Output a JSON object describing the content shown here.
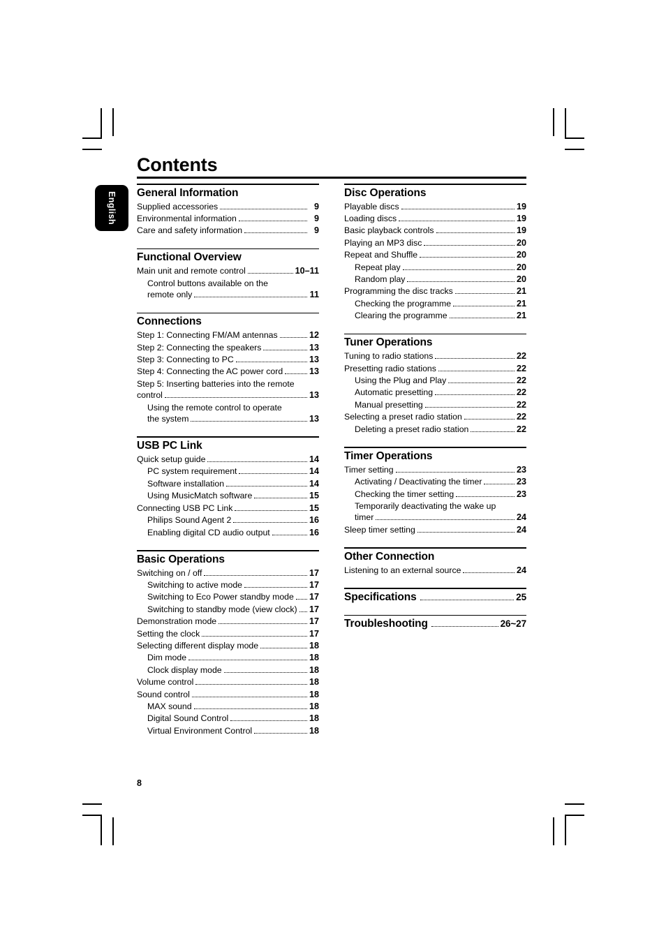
{
  "page": {
    "title": "Contents",
    "language_tab": "English",
    "folio": "8"
  },
  "left_column": [
    {
      "heading": "General Information",
      "entries": [
        {
          "text": "Supplied accessories",
          "page": "9",
          "level": 0
        },
        {
          "text": "Environmental information",
          "page": "9",
          "level": 0
        },
        {
          "text": "Care and safety information",
          "page": "9",
          "level": 0
        }
      ]
    },
    {
      "heading": "Functional Overview",
      "entries": [
        {
          "text": "Main unit and remote control",
          "page": "10–11",
          "level": 0
        },
        {
          "text": "Control buttons available on the",
          "page": "",
          "level": 1,
          "wrap": "first"
        },
        {
          "text": "remote only",
          "page": "11",
          "level": 1,
          "wrap": "last"
        }
      ]
    },
    {
      "heading": "Connections",
      "entries": [
        {
          "text": "Step 1: Connecting FM/AM antennas",
          "page": "12",
          "level": 0
        },
        {
          "text": "Step 2: Connecting the speakers",
          "page": "13",
          "level": 0
        },
        {
          "text": "Step 3: Connecting to PC",
          "page": "13",
          "level": 0
        },
        {
          "text": "Step 4: Connecting the AC power cord",
          "page": "13",
          "level": 0
        },
        {
          "text": "Step 5: Inserting batteries into the remote",
          "page": "",
          "level": 0,
          "wrap": "first"
        },
        {
          "text": "control",
          "page": "13",
          "level": 0,
          "wrap": "last"
        },
        {
          "text": "Using the remote control to operate",
          "page": "",
          "level": 1,
          "wrap": "first"
        },
        {
          "text": "the system",
          "page": "13",
          "level": 1,
          "wrap": "last"
        }
      ]
    },
    {
      "heading": "USB PC Link",
      "entries": [
        {
          "text": "Quick setup guide",
          "page": "14",
          "level": 0
        },
        {
          "text": "PC system requirement",
          "page": "14",
          "level": 1
        },
        {
          "text": "Software installation",
          "page": "14",
          "level": 1
        },
        {
          "text": "Using MusicMatch software",
          "page": "15",
          "level": 1
        },
        {
          "text": "Connecting USB PC Link",
          "page": "15",
          "level": 0
        },
        {
          "text": "Philips Sound Agent 2",
          "page": "16",
          "level": 1
        },
        {
          "text": "Enabling digital CD audio output",
          "page": "16",
          "level": 1
        }
      ]
    },
    {
      "heading": "Basic Operations",
      "entries": [
        {
          "text": "Switching on / off",
          "page": "17",
          "level": 0
        },
        {
          "text": "Switching to active mode",
          "page": "17",
          "level": 1
        },
        {
          "text": "Switching to Eco Power standby mode",
          "page": "17",
          "level": 1
        },
        {
          "text": "Switching to standby mode (view clock)",
          "page": "17",
          "level": 1
        },
        {
          "text": "Demonstration mode",
          "page": "17",
          "level": 0
        },
        {
          "text": "Setting the clock",
          "page": "17",
          "level": 0
        },
        {
          "text": "Selecting different display mode",
          "page": "18",
          "level": 0
        },
        {
          "text": "Dim mode",
          "page": "18",
          "level": 1
        },
        {
          "text": "Clock display mode",
          "page": "18",
          "level": 1
        },
        {
          "text": "Volume control",
          "page": "18",
          "level": 0
        },
        {
          "text": "Sound control",
          "page": "18",
          "level": 0
        },
        {
          "text": "MAX sound",
          "page": "18",
          "level": 1
        },
        {
          "text": "Digital Sound Control",
          "page": "18",
          "level": 1
        },
        {
          "text": "Virtual Environment Control",
          "page": "18",
          "level": 1
        }
      ]
    }
  ],
  "right_column": [
    {
      "heading": "Disc Operations",
      "entries": [
        {
          "text": "Playable discs",
          "page": "19",
          "level": 0
        },
        {
          "text": "Loading discs",
          "page": "19",
          "level": 0
        },
        {
          "text": "Basic playback controls",
          "page": "19",
          "level": 0
        },
        {
          "text": "Playing an MP3 disc",
          "page": "20",
          "level": 0
        },
        {
          "text": "Repeat and Shuffle",
          "page": "20",
          "level": 0
        },
        {
          "text": "Repeat play",
          "page": "20",
          "level": 1
        },
        {
          "text": "Random play",
          "page": "20",
          "level": 1
        },
        {
          "text": "Programming the disc tracks",
          "page": "21",
          "level": 0
        },
        {
          "text": "Checking the programme",
          "page": "21",
          "level": 1
        },
        {
          "text": "Clearing the programme",
          "page": "21",
          "level": 1
        }
      ]
    },
    {
      "heading": "Tuner Operations",
      "entries": [
        {
          "text": "Tuning to radio stations",
          "page": "22",
          "level": 0
        },
        {
          "text": "Presetting radio stations",
          "page": "22",
          "level": 0
        },
        {
          "text": "Using the Plug and Play",
          "page": "22",
          "level": 1
        },
        {
          "text": "Automatic presetting",
          "page": "22",
          "level": 1
        },
        {
          "text": "Manual presetting",
          "page": "22",
          "level": 1
        },
        {
          "text": "Selecting a preset radio station",
          "page": "22",
          "level": 0
        },
        {
          "text": "Deleting a preset radio station",
          "page": "22",
          "level": 1
        }
      ]
    },
    {
      "heading": "Timer Operations",
      "entries": [
        {
          "text": "Timer setting",
          "page": "23",
          "level": 0
        },
        {
          "text": "Activating / Deactivating the timer",
          "page": "23",
          "level": 1
        },
        {
          "text": "Checking the timer setting",
          "page": "23",
          "level": 1
        },
        {
          "text": "Temporarily deactivating the wake up",
          "page": "",
          "level": 1,
          "wrap": "first"
        },
        {
          "text": "timer",
          "page": "24",
          "level": 1,
          "wrap": "last"
        },
        {
          "text": "Sleep timer setting",
          "page": "24",
          "level": 0
        }
      ]
    },
    {
      "heading": "Other Connection",
      "entries": [
        {
          "text": "Listening to an external source",
          "page": "24",
          "level": 0
        }
      ]
    },
    {
      "heading": "Specifications",
      "heading_page": "25",
      "entries": []
    },
    {
      "heading": "Troubleshooting",
      "heading_page": "26~27",
      "entries": []
    }
  ]
}
